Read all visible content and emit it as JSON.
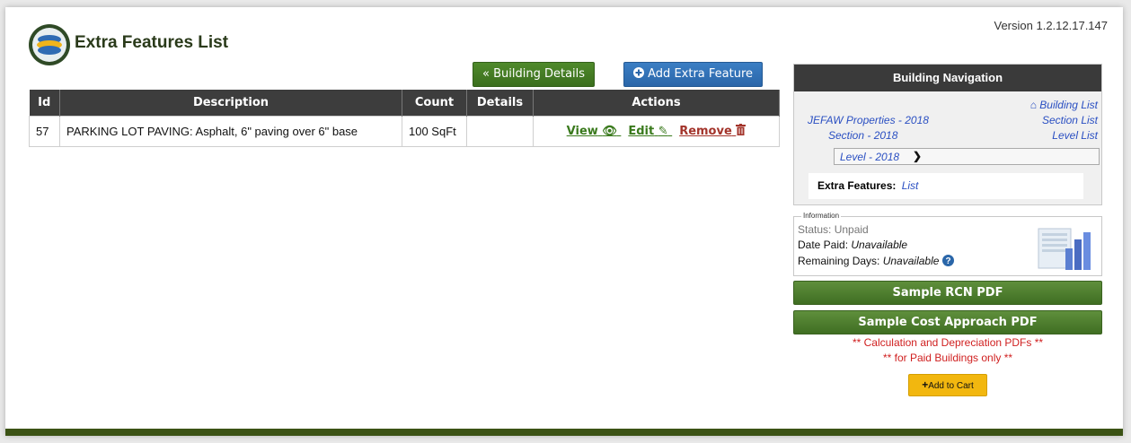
{
  "header": {
    "title": "Extra Features List",
    "version": "Version 1.2.12.17.147"
  },
  "toolbar": {
    "building_details_label": "Building Details",
    "add_extra_feature_label": "Add Extra Feature"
  },
  "table": {
    "columns": [
      "Id",
      "Description",
      "Count",
      "Details",
      "Actions"
    ],
    "rows": [
      {
        "id": "57",
        "description": "PARKING LOT PAVING: Asphalt, 6\" paving over 6\" base",
        "count": "100 SqFt",
        "details": "",
        "actions": {
          "view": "View",
          "edit": "Edit",
          "remove": "Remove"
        }
      }
    ]
  },
  "navigation": {
    "title": "Building Navigation",
    "building_list": "Building List",
    "properties": "JEFAW Properties - 2018",
    "section_list": "Section List",
    "section": "Section - 2018",
    "level_list": "Level List",
    "level": "Level - 2018",
    "extra_features_label": "Extra Features:",
    "extra_features_link": "List"
  },
  "information": {
    "legend": "Information",
    "status": "Status: Unpaid",
    "date_paid_label": "Date Paid:",
    "date_paid_value": "Unavailable",
    "remaining_label": "Remaining Days:",
    "remaining_value": "Unavailable"
  },
  "pdf": {
    "rcn_label": "Sample RCN PDF",
    "cost_label": "Sample Cost Approach PDF",
    "warning_line1": "** Calculation and Depreciation PDFs **",
    "warning_line2": "** for Paid Buildings only **",
    "cart_label": "Add to Cart"
  },
  "colors": {
    "primary_green": "#3b6e1d",
    "primary_blue": "#2a66a9",
    "header_dark": "#3d3d3d",
    "warning_red": "#d02020",
    "cart_yellow": "#f2b70f"
  }
}
